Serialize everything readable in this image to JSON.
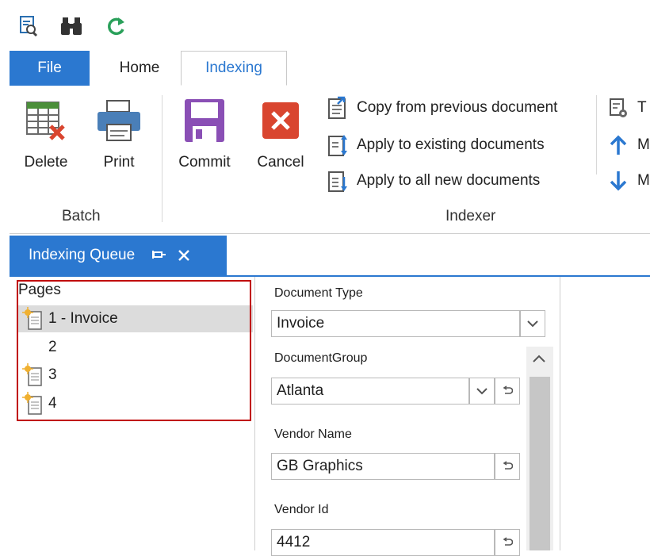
{
  "quick_access": {
    "icons": [
      "search-document-icon",
      "binoculars-icon",
      "refresh-icon"
    ]
  },
  "ribbon_tabs": {
    "file": "File",
    "home": "Home",
    "indexing": "Indexing"
  },
  "ribbon": {
    "batch_group": {
      "label": "Batch",
      "delete": "Delete",
      "print": "Print"
    },
    "indexer_group": {
      "label": "Indexer",
      "commit": "Commit",
      "cancel": "Cancel",
      "copy_prev": "Copy from previous document",
      "apply_existing": "Apply to existing documents",
      "apply_new": "Apply to all new documents"
    },
    "overflow": {
      "t_label": "T",
      "m_label_1": "M",
      "m_label_2": "M"
    }
  },
  "panel": {
    "tab_label": "Indexing Queue"
  },
  "pages": {
    "header": "Pages",
    "items": [
      {
        "label": "1 - Invoice",
        "new": true,
        "selected": true
      },
      {
        "label": "2",
        "new": false,
        "selected": false
      },
      {
        "label": "3",
        "new": true,
        "selected": false
      },
      {
        "label": "4",
        "new": true,
        "selected": false
      }
    ]
  },
  "form": {
    "document_type": {
      "label": "Document Type",
      "value": "Invoice"
    },
    "document_group": {
      "label": "DocumentGroup",
      "value": "Atlanta"
    },
    "vendor_name": {
      "label": "Vendor Name",
      "value": "GB Graphics"
    },
    "vendor_id": {
      "label": "Vendor Id",
      "value": "4412"
    }
  },
  "colors": {
    "accent": "#2b78d0",
    "highlight_border": "#c00000",
    "cancel_red": "#d9452f",
    "commit_purple": "#8a4fb5"
  }
}
